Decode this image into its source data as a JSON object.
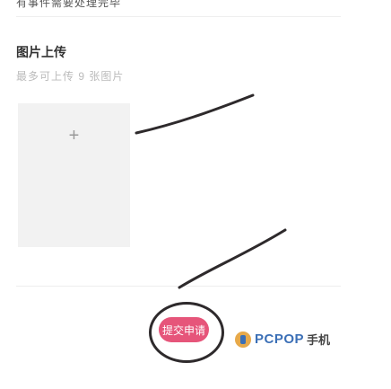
{
  "header": {
    "note": "有事件需要处理完毕"
  },
  "upload": {
    "title": "图片上传",
    "hint": "最多可上传 9 张图片",
    "add_symbol": "+"
  },
  "actions": {
    "submit_label": "提交申请"
  },
  "watermark": {
    "brand": "PCPOP",
    "suffix": "手机"
  },
  "colors": {
    "submit_bg": "#e6557a",
    "stroke": "#2e2a2c",
    "upload_bg": "#f2f2f2"
  }
}
